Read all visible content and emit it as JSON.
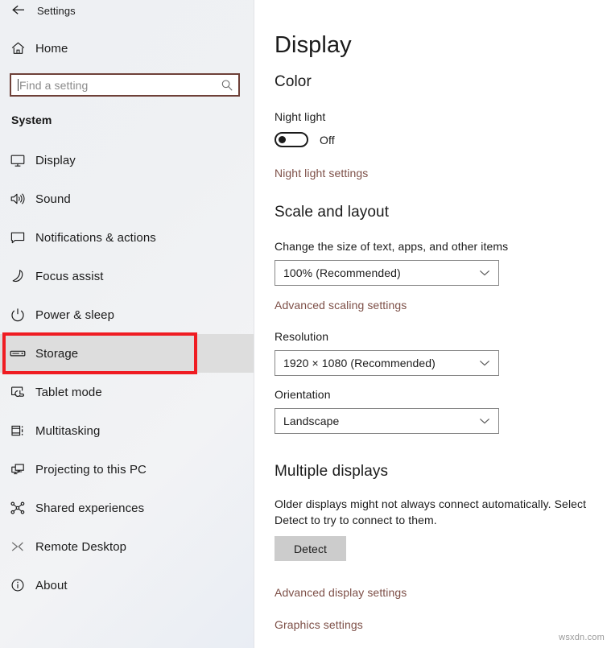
{
  "window": {
    "titlebar": {
      "back_icon": "back-arrow-icon",
      "title": "Settings"
    }
  },
  "sidebar": {
    "home": {
      "label": "Home",
      "icon": "home-icon"
    },
    "search": {
      "placeholder": "Find a setting",
      "value": "",
      "icon": "search-icon"
    },
    "section_title": "System",
    "selected_item": "Storage",
    "highlight_color": "#ef1c22",
    "items": [
      {
        "label": "Display",
        "icon": "monitor-icon",
        "selected": false
      },
      {
        "label": "Sound",
        "icon": "speaker-icon",
        "selected": false
      },
      {
        "label": "Notifications & actions",
        "icon": "speech-bubble-icon",
        "selected": false
      },
      {
        "label": "Focus assist",
        "icon": "moon-icon",
        "selected": false
      },
      {
        "label": "Power & sleep",
        "icon": "power-icon",
        "selected": false
      },
      {
        "label": "Storage",
        "icon": "drive-icon",
        "selected": true
      },
      {
        "label": "Tablet mode",
        "icon": "tablet-tap-icon",
        "selected": false
      },
      {
        "label": "Multitasking",
        "icon": "multitask-icon",
        "selected": false
      },
      {
        "label": "Projecting to this PC",
        "icon": "project-screen-icon",
        "selected": false
      },
      {
        "label": "Shared experiences",
        "icon": "share-nodes-icon",
        "selected": false
      },
      {
        "label": "Remote Desktop",
        "icon": "remote-desktop-icon",
        "selected": false
      },
      {
        "label": "About",
        "icon": "info-icon",
        "selected": false
      }
    ]
  },
  "content": {
    "page_title": "Display",
    "link_color": "#7d4f47",
    "color_section": {
      "heading": "Color",
      "night_light_label": "Night light",
      "night_light_state": "Off",
      "night_light_on": false,
      "night_light_settings_link": "Night light settings"
    },
    "scale_section": {
      "heading": "Scale and layout",
      "scale_label": "Change the size of text, apps, and other items",
      "scale_value": "100% (Recommended)",
      "advanced_scaling_link": "Advanced scaling settings",
      "resolution_label": "Resolution",
      "resolution_value": "1920 × 1080 (Recommended)",
      "orientation_label": "Orientation",
      "orientation_value": "Landscape"
    },
    "multiple_displays_section": {
      "heading": "Multiple displays",
      "description": "Older displays might not always connect automatically. Select Detect to try to connect to them.",
      "detect_button": "Detect",
      "advanced_display_link": "Advanced display settings",
      "graphics_settings_link": "Graphics settings"
    }
  },
  "watermark": "wsxdn.com"
}
